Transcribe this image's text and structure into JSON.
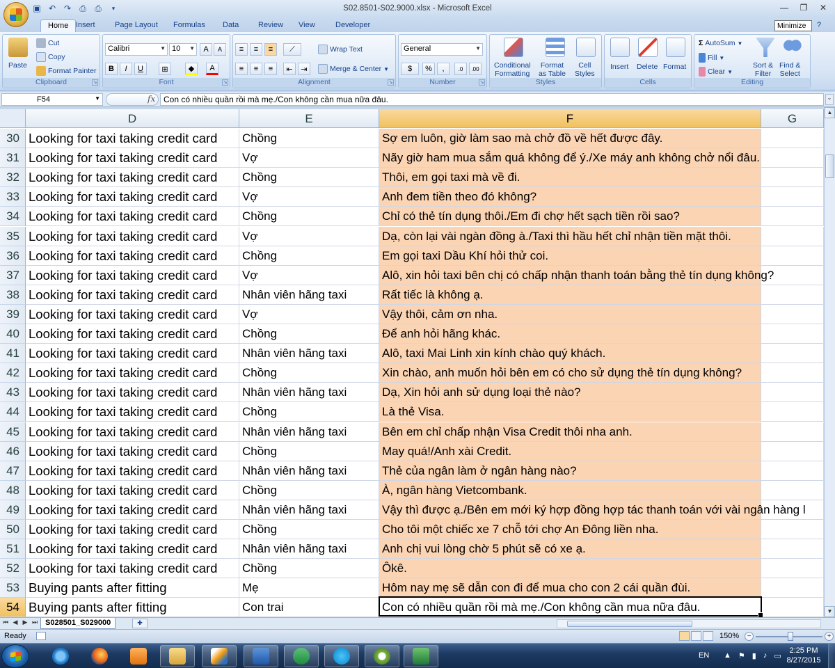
{
  "window": {
    "title": "S02.8501-S02.9000.xlsx - Microsoft Excel",
    "tooltip": "Minimize"
  },
  "ribbon": {
    "tabs": [
      "Home",
      "Insert",
      "Page Layout",
      "Formulas",
      "Data",
      "Review",
      "View",
      "Developer"
    ],
    "active_tab": "Home",
    "clipboard": {
      "paste": "Paste",
      "cut": "Cut",
      "copy": "Copy",
      "format_painter": "Format Painter",
      "label": "Clipboard"
    },
    "font": {
      "name": "Calibri",
      "size": "10",
      "label": "Font",
      "bold": "B",
      "italic": "I",
      "underline": "U"
    },
    "alignment": {
      "wrap_text": "Wrap Text",
      "merge_center": "Merge & Center",
      "label": "Alignment"
    },
    "number": {
      "format": "General",
      "currency": "$",
      "percent": "%",
      "comma": ",",
      "label": "Number"
    },
    "styles": {
      "conditional_1": "Conditional",
      "conditional_2": "Formatting",
      "format_table_1": "Format",
      "format_table_2": "as Table",
      "cell_styles_1": "Cell",
      "cell_styles_2": "Styles",
      "label": "Styles"
    },
    "cells": {
      "insert": "Insert",
      "delete": "Delete",
      "format": "Format",
      "label": "Cells"
    },
    "editing": {
      "autosum": "AutoSum",
      "fill": "Fill",
      "clear": "Clear",
      "sort_1": "Sort &",
      "sort_2": "Filter",
      "find_1": "Find &",
      "find_2": "Select",
      "label": "Editing"
    }
  },
  "formula_bar": {
    "name_box": "F54",
    "fx": "fx",
    "content": "Con có nhiều quần rồi mà mẹ./Con không cần mua nữa đâu."
  },
  "columns": [
    "D",
    "E",
    "F",
    "G"
  ],
  "selected_column": "F",
  "rows": [
    {
      "n": "30",
      "d": "Looking for taxi taking credit card",
      "e": "Chồng",
      "f": "Sợ em luôn, giờ làm sao mà chở đồ về hết được đây."
    },
    {
      "n": "31",
      "d": "Looking for taxi taking credit card",
      "e": "Vợ",
      "f": "Nãy giờ ham mua sắm quá không để ý./Xe máy anh không chở nổi đâu."
    },
    {
      "n": "32",
      "d": "Looking for taxi taking credit card",
      "e": "Chồng",
      "f": "Thôi, em gọi taxi mà về đi."
    },
    {
      "n": "33",
      "d": "Looking for taxi taking credit card",
      "e": "Vợ",
      "f": "Anh đem tiền theo đó không?"
    },
    {
      "n": "34",
      "d": "Looking for taxi taking credit card",
      "e": "Chồng",
      "f": "Chỉ có thẻ tín dụng thôi./Em đi chợ hết sạch tiền rồi sao?"
    },
    {
      "n": "35",
      "d": "Looking for taxi taking credit card",
      "e": "Vợ",
      "f": "Dạ, còn lại vài ngàn đồng à./Taxi thì hầu hết chỉ nhận tiền mặt thôi."
    },
    {
      "n": "36",
      "d": "Looking for taxi taking credit card",
      "e": "Chồng",
      "f": "Em gọi taxi Dầu Khí hỏi thử coi."
    },
    {
      "n": "37",
      "d": "Looking for taxi taking credit card",
      "e": "Vợ",
      "f": "Alô, xin hỏi taxi bên chị có chấp nhận thanh toán bằng thẻ tín dụng không?"
    },
    {
      "n": "38",
      "d": "Looking for taxi taking credit card",
      "e": "Nhân viên hãng taxi",
      "f": "Rất tiếc là không ạ."
    },
    {
      "n": "39",
      "d": "Looking for taxi taking credit card",
      "e": "Vợ",
      "f": "Vậy thôi, cảm ơn nha."
    },
    {
      "n": "40",
      "d": "Looking for taxi taking credit card",
      "e": "Chồng",
      "f": "Để anh hỏi hãng khác."
    },
    {
      "n": "41",
      "d": "Looking for taxi taking credit card",
      "e": "Nhân viên hãng taxi",
      "f": "Alô, taxi Mai Linh xin kính chào quý khách."
    },
    {
      "n": "42",
      "d": "Looking for taxi taking credit card",
      "e": "Chồng",
      "f": "Xin chào, anh muốn hỏi bên em có cho sử dụng thẻ tín dụng không?"
    },
    {
      "n": "43",
      "d": "Looking for taxi taking credit card",
      "e": "Nhân viên hãng taxi",
      "f": "Dạ, Xin hỏi anh sử dụng loại thẻ nào?"
    },
    {
      "n": "44",
      "d": "Looking for taxi taking credit card",
      "e": "Chồng",
      "f": "Là thẻ Visa."
    },
    {
      "n": "45",
      "d": "Looking for taxi taking credit card",
      "e": "Nhân viên hãng taxi",
      "f": "Bên em chỉ chấp nhận Visa Credit thôi nha anh."
    },
    {
      "n": "46",
      "d": "Looking for taxi taking credit card",
      "e": "Chồng",
      "f": "May quá!/Anh xài Credit."
    },
    {
      "n": "47",
      "d": "Looking for taxi taking credit card",
      "e": "Nhân viên hãng taxi",
      "f": "Thẻ của ngân làm ở ngân hàng nào?"
    },
    {
      "n": "48",
      "d": "Looking for taxi taking credit card",
      "e": "Chồng",
      "f": "À, ngân hàng Vietcombank."
    },
    {
      "n": "49",
      "d": "Looking for taxi taking credit card",
      "e": "Nhân viên hãng taxi",
      "f": "Vậy thì được ạ./Bên em mới ký hợp đồng hợp tác thanh toán với vài ngân hàng l"
    },
    {
      "n": "50",
      "d": "Looking for taxi taking credit card",
      "e": "Chồng",
      "f": "Cho tôi một chiếc xe 7 chỗ tới chợ An Đông liền nha."
    },
    {
      "n": "51",
      "d": "Looking for taxi taking credit card",
      "e": "Nhân viên hãng taxi",
      "f": "Anh chị vui lòng chờ 5 phút sẽ có xe ạ."
    },
    {
      "n": "52",
      "d": "Looking for taxi taking credit card",
      "e": "Chồng",
      "f": "Ôkê."
    },
    {
      "n": "53",
      "d": "Buying pants after fitting",
      "e": "Mẹ",
      "f": "Hôm nay mẹ sẽ dẫn con đi để mua cho con 2 cái quần đùi."
    },
    {
      "n": "54",
      "d": "Buying pants after fitting",
      "e": "Con trai",
      "f": "Con có nhiều quần rồi mà mẹ./Con không cần mua nữa đâu."
    }
  ],
  "sheet_tab": "S028501_S029000",
  "status": {
    "ready": "Ready",
    "zoom": "150%"
  },
  "taskbar": {
    "lang": "EN",
    "time": "2:25 PM",
    "date": "8/27/2015"
  }
}
